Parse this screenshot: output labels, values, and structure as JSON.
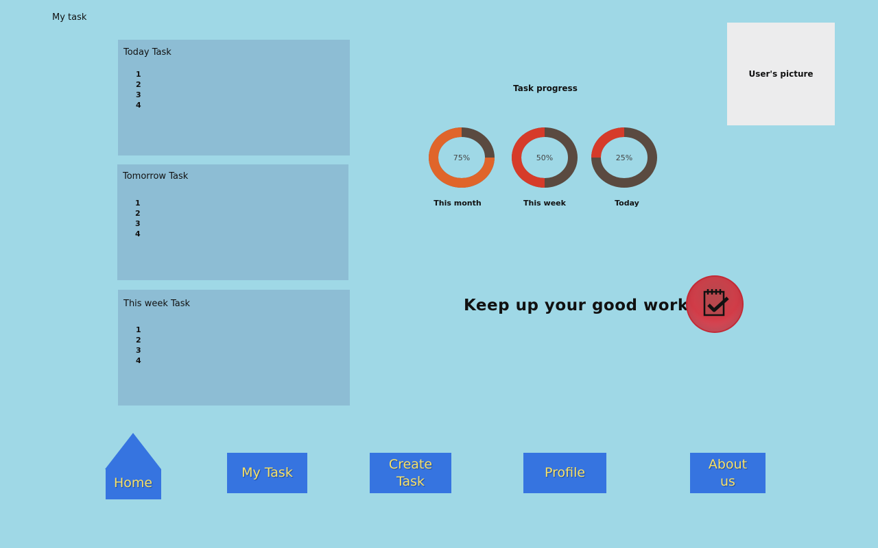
{
  "header": {
    "title": "My task"
  },
  "panels": [
    {
      "title": "Today Task",
      "items": [
        "1",
        "2",
        "3",
        "4"
      ]
    },
    {
      "title": "Tomorrow Task",
      "items": [
        "1",
        "2",
        "3",
        "4"
      ]
    },
    {
      "title": "This week Task",
      "items": [
        "1",
        "2",
        "3",
        "4"
      ]
    }
  ],
  "user": {
    "picture_label": "User's picture"
  },
  "progress": {
    "title": "Task progress",
    "rings": [
      {
        "label": "This month",
        "percent_text": "75%",
        "value": 75
      },
      {
        "label": "This week",
        "percent_text": "50%",
        "value": 50
      },
      {
        "label": "Today",
        "percent_text": "25%",
        "value": 25
      }
    ],
    "colors": {
      "fill": "#d63b2a",
      "fill_start": "#e0652a",
      "track": "#5a4a40"
    }
  },
  "motivation": {
    "text": "Keep up your good work!",
    "icon": "clipboard-check-icon"
  },
  "nav": {
    "home": "Home",
    "my_task": "My Task",
    "create_task": "Create Task",
    "profile": "Profile",
    "about_us": "About us"
  },
  "colors": {
    "background": "#9fd8e6",
    "panel": "#8dbdd4",
    "nav_button": "#3674e0",
    "nav_text": "#f7e16a"
  }
}
